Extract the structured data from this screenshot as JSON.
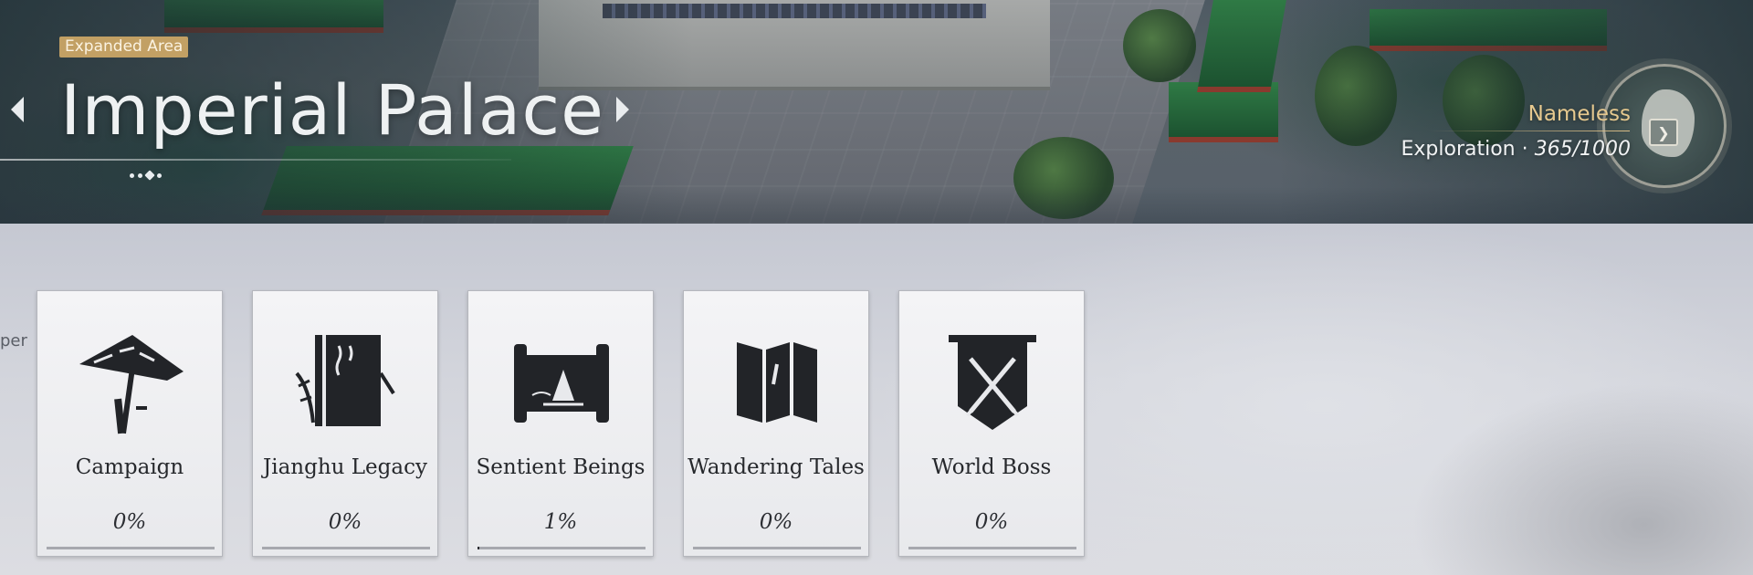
{
  "header": {
    "area_badge": "Expanded Area",
    "area_title": "Imperial Palace",
    "region_name": "Nameless",
    "exploration_label": "Exploration · ",
    "exploration_value": "365/1000",
    "page_dots": 3,
    "active_dot": 2
  },
  "side_text": "per",
  "cards": [
    {
      "label": "Campaign",
      "percent": "0%",
      "progress": 0,
      "icon": "straw-hat-icon"
    },
    {
      "label": "Jianghu Legacy",
      "percent": "0%",
      "progress": 0,
      "icon": "book-icon"
    },
    {
      "label": "Sentient Beings",
      "percent": "1%",
      "progress": 0.01,
      "icon": "scroll-icon"
    },
    {
      "label": "Wandering Tales",
      "percent": "0%",
      "progress": 0,
      "icon": "folded-map-icon"
    },
    {
      "label": "World Boss",
      "percent": "0%",
      "progress": 0,
      "icon": "crossed-swords-banner-icon"
    }
  ],
  "colors": {
    "badge": "#c2a064",
    "region_name": "#e6c98f",
    "card_bg": "#f0f0f2",
    "icon_ink": "#222428"
  }
}
